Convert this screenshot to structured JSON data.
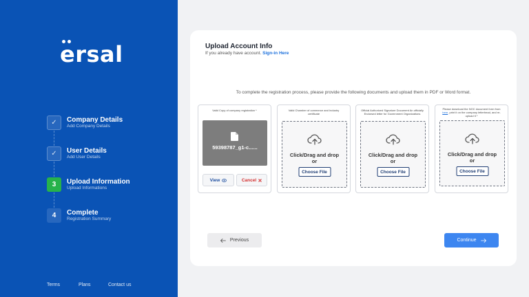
{
  "brand": {
    "logo_text": "ersal"
  },
  "steps": [
    {
      "number": "✓",
      "title": "Company Details",
      "subtitle": "Add Company Details",
      "state": "done"
    },
    {
      "number": "✓",
      "title": "User Details",
      "subtitle": "Add User Details",
      "state": "done"
    },
    {
      "number": "3",
      "title": "Upload Information",
      "subtitle": "Upload Informations",
      "state": "active"
    },
    {
      "number": "4",
      "title": "Complete",
      "subtitle": "Registration Summary",
      "state": "todo"
    }
  ],
  "footer": {
    "terms": "Terms",
    "plans": "Plans",
    "contact": "Contact us"
  },
  "card": {
    "title": "Upload Account Info",
    "subtitle_prefix": "If you already have account.",
    "signin_link": "Sign-in Here",
    "instructions": "To complete the registration process, please provide the following documents and upload them in PDF or Word format."
  },
  "documents": [
    {
      "label": "Valid Copy of company registration *",
      "uploaded": true,
      "file_name": "59398787_g1-c......",
      "view_label": "View",
      "cancel_label": "Cancel"
    },
    {
      "label": "Valid Chamber of commerce and Industry certificate",
      "drop_text_1": "Click/Drag and drop",
      "drop_text_2": "or",
      "choose_label": "Choose File"
    },
    {
      "label": "Official Authorized Signature Document An officially Endorsed letter for Government Organizations",
      "drop_text_1": "Click/Drag and drop",
      "drop_text_2": "or",
      "choose_label": "Choose File"
    },
    {
      "label_pre": "Please download the NOC document form from",
      "label_link": "here",
      "label_post": ", print it on the company letterhead, and re-upload it *",
      "drop_text_1": "Click/Drag and drop",
      "drop_text_2": "or",
      "choose_label": "Choose File"
    }
  ],
  "nav": {
    "previous": "Previous",
    "continue": "Continue"
  },
  "colors": {
    "sidebar": "#0a53b5",
    "active_step": "#27b24a",
    "primary_button": "#3d86f0",
    "cancel": "#d32f2f"
  }
}
